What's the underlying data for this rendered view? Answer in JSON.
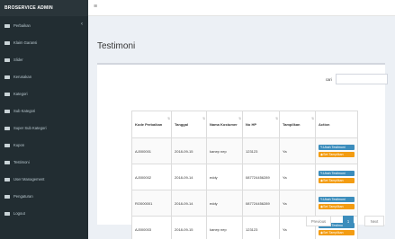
{
  "app": {
    "brand": "BROSERVICE ADMIN"
  },
  "sidebar": {
    "items": [
      {
        "label": "Perbaikan",
        "has_children": true
      },
      {
        "label": "Klaim Garansi"
      },
      {
        "label": "Slider"
      },
      {
        "label": "Kerusakan"
      },
      {
        "label": "Kategori"
      },
      {
        "label": "Sub Kategori"
      },
      {
        "label": "Super Sub Kategori"
      },
      {
        "label": "Kupon"
      },
      {
        "label": "Testimoni"
      },
      {
        "label": "User Management"
      },
      {
        "label": "Pengaturan"
      },
      {
        "label": "Logout"
      }
    ]
  },
  "topbar": {
    "menu_icon": "hamburger-icon"
  },
  "main": {
    "title": "Testimoni",
    "search": {
      "label": "cari",
      "value": "",
      "placeholder": ""
    },
    "table": {
      "headers": [
        "Kode Perbaikan",
        "Tanggal",
        "Nama Kostumer",
        "No HP",
        "Tampilkan",
        "Action"
      ],
      "rows": [
        {
          "kode": "AJ000001",
          "tanggal": "2018-09-15",
          "nama": "kanep nep",
          "hp": "123123",
          "tampilkan": "Ya"
        },
        {
          "kode": "AJ000002",
          "tanggal": "2018-09-14",
          "nama": "eddy",
          "hp": "087724456289",
          "tampilkan": "Ya"
        },
        {
          "kode": "RO000001",
          "tanggal": "2018-09-14",
          "nama": "eddy",
          "hp": "087724456289",
          "tampilkan": "Ya"
        },
        {
          "kode": "AJ000003",
          "tanggal": "2018-09-15",
          "nama": "kanep nep",
          "hp": "123123",
          "tampilkan": "Ya"
        }
      ],
      "action_labels": {
        "edit": "Ubah Testimoni",
        "show": "Set Tampilkan"
      }
    },
    "pagination": {
      "previous": "Previous",
      "current": "1",
      "next": "Next"
    }
  }
}
